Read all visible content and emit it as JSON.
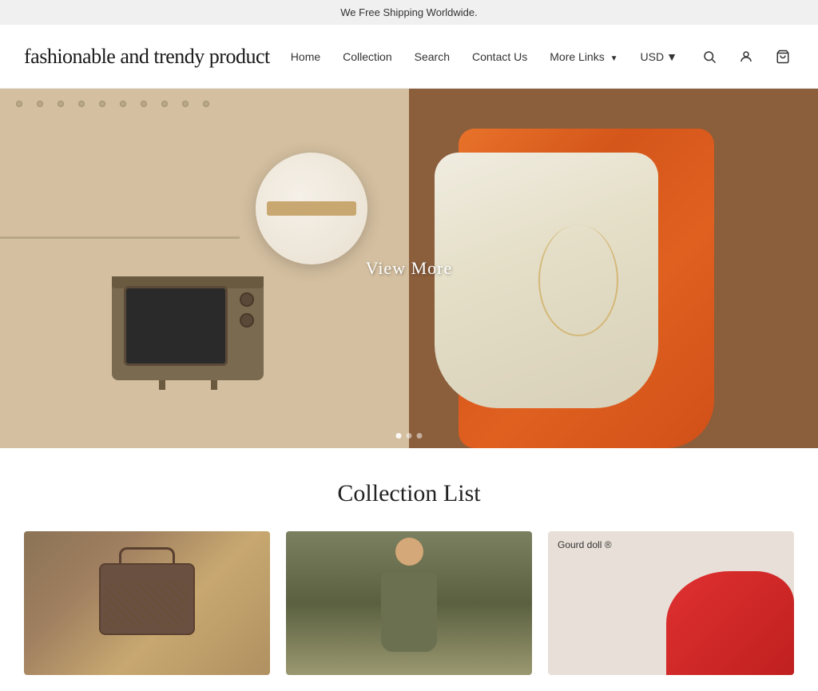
{
  "banner": {
    "text": "We Free Shipping Worldwide."
  },
  "header": {
    "logo": "fashionable and trendy product",
    "nav": {
      "home": "Home",
      "collection": "Collection",
      "search": "Search",
      "contact": "Contact Us",
      "more_links": "More Links",
      "currency": "USD"
    },
    "icons": {
      "search": "🔍",
      "account": "👤",
      "cart": "🛒"
    }
  },
  "hero": {
    "view_more_label": "View More",
    "slide_count": 3,
    "active_slide": 1
  },
  "collection_section": {
    "title": "Collection List",
    "cards": [
      {
        "id": 1,
        "label": ""
      },
      {
        "id": 2,
        "label": ""
      },
      {
        "id": 3,
        "label": "Gourd doll ®"
      }
    ]
  }
}
